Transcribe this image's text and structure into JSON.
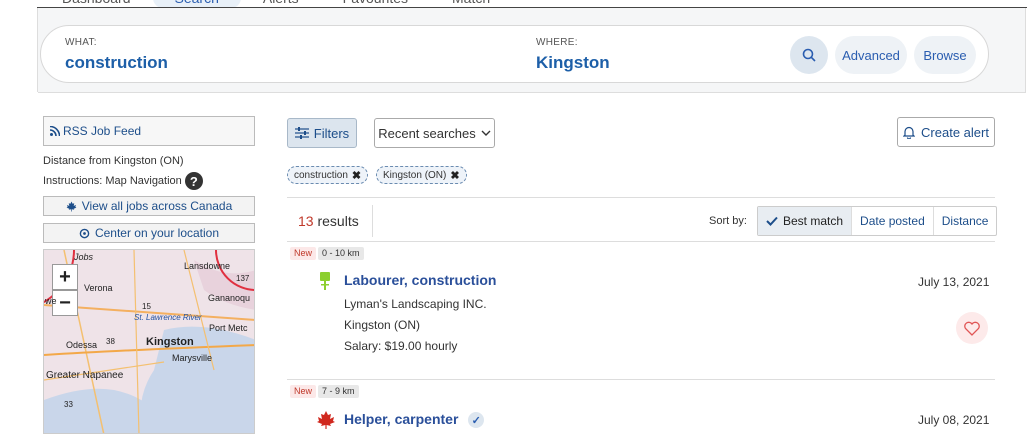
{
  "tabs": [
    {
      "label": "Dashboard"
    },
    {
      "label": "Search"
    },
    {
      "label": "Alerts"
    },
    {
      "label": "Favourites"
    },
    {
      "label": "Match"
    }
  ],
  "search": {
    "what_label": "WHAT:",
    "what_value": "construction",
    "where_label": "WHERE:",
    "where_value": "Kingston",
    "advanced_label": "Advanced",
    "browse_label": "Browse"
  },
  "left": {
    "rss_label": "RSS Job Feed",
    "distance_text": "Distance from Kingston (ON)",
    "instructions_text": "Instructions: Map Navigation",
    "view_all_label": "View all jobs across Canada",
    "center_label": "Center on your location",
    "map_labels": {
      "jobs": "Jobs",
      "lansdowne": "Lansdowne",
      "num137": "137",
      "verona": "Verona",
      "gananoque": "Gananoqu",
      "num15": "15",
      "st_lawrence": "St. Lawrence River",
      "port_metc": "Port Metc",
      "odessa": "Odessa",
      "num38": "38",
      "kingston": "Kingston",
      "marysville": "Marysville",
      "greater_napanee": "Greater Napanee",
      "num33": "33",
      "we": "we"
    }
  },
  "toolbar": {
    "filters_label": "Filters",
    "recent_label": "Recent searches",
    "alert_label": "Create alert"
  },
  "chips": [
    {
      "label": "construction"
    },
    {
      "label": "Kingston (ON)"
    }
  ],
  "results": {
    "count": "13",
    "count_suffix": "results",
    "sort_by_label": "Sort by:",
    "sort_options": [
      {
        "label": "Best match",
        "active": true
      },
      {
        "label": "Date posted"
      },
      {
        "label": "Distance"
      }
    ]
  },
  "jobs": [
    {
      "new_tag": "New",
      "distance": "0 - 10 km",
      "title": "Labourer, construction",
      "company": "Lyman's Landscaping INC.",
      "location": "Kingston (ON)",
      "salary": "Salary: $19.00 hourly",
      "date": "July 13, 2021",
      "icon": "green-pin-icon"
    },
    {
      "new_tag": "New",
      "distance": "7 - 9 km",
      "title": "Helper, carpenter",
      "date": "July 08, 2021",
      "icon": "maple-leaf-icon"
    }
  ],
  "colors": {
    "accent": "#1d5fa8",
    "link": "#2a4f9a",
    "new_tag": "#c0392b",
    "heart": "#e05555",
    "maple": "#d0281e",
    "pin": "#8ccf2f"
  }
}
